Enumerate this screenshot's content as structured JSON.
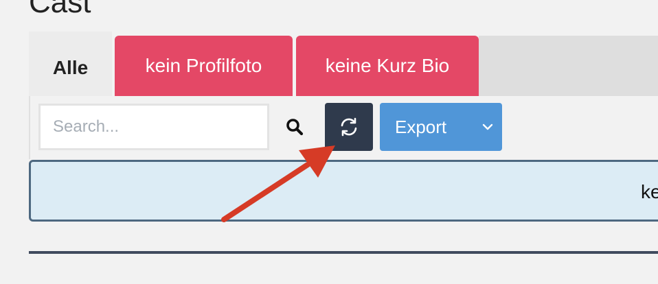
{
  "page": {
    "title": "Cast"
  },
  "tabs": [
    {
      "label": "Alle",
      "active": true
    },
    {
      "label": "kein Profilfoto",
      "active": false,
      "color": "#e44866"
    },
    {
      "label": "keine Kurz Bio",
      "active": false,
      "color": "#e44866"
    }
  ],
  "toolbar": {
    "search_placeholder": "Search...",
    "search_value": "",
    "search_icon": "search-icon",
    "refresh_icon": "refresh-icon",
    "export_label": "Export",
    "export_caret_icon": "chevron-down-icon"
  },
  "info": {
    "text": "ke"
  },
  "colors": {
    "tab_alert": "#e44866",
    "refresh_button": "#2f3a4c",
    "export_button": "#5096d8",
    "info_background": "#dcecf5",
    "annotation_arrow": "#d63b26"
  }
}
